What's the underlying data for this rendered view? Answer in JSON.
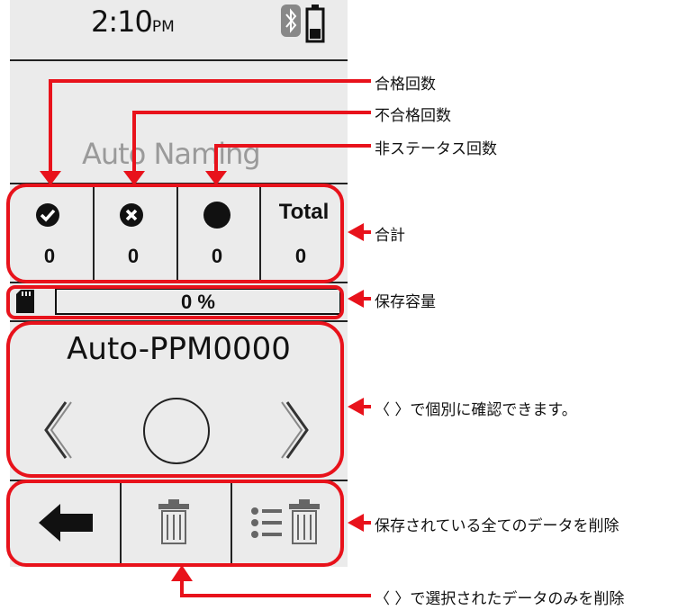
{
  "status": {
    "time": "2:10",
    "ampm": "PM"
  },
  "header": {
    "naming_mode": "Auto Naming"
  },
  "totals": {
    "columns": [
      {
        "icon": "check-circle-icon",
        "count": "0"
      },
      {
        "icon": "x-circle-icon",
        "count": "0"
      },
      {
        "icon": "filled-circle-icon",
        "count": "0"
      },
      {
        "label": "Total",
        "count": "0"
      }
    ]
  },
  "storage": {
    "percent": "0 %",
    "fill_fraction": 0.0
  },
  "record": {
    "name": "Auto-PPM0000"
  },
  "toolbar": {
    "back_icon": "back-arrow-icon",
    "delete_icon": "trash-icon",
    "delete_all_icon": "list-trash-icon"
  },
  "callouts": {
    "pass_count": "合格回数",
    "fail_count": "不合格回数",
    "no_status_count": "非ステータス回数",
    "total": "合計",
    "storage": "保存容量",
    "navigate": "〈 〉で個別に確認できます。",
    "delete_all": "保存されている全てのデータを削除",
    "delete_selected": "〈 〉で選択されたデータのみを削除"
  },
  "colors": {
    "accent_red": "#e8121b",
    "screen_bg": "#ebebeb"
  }
}
